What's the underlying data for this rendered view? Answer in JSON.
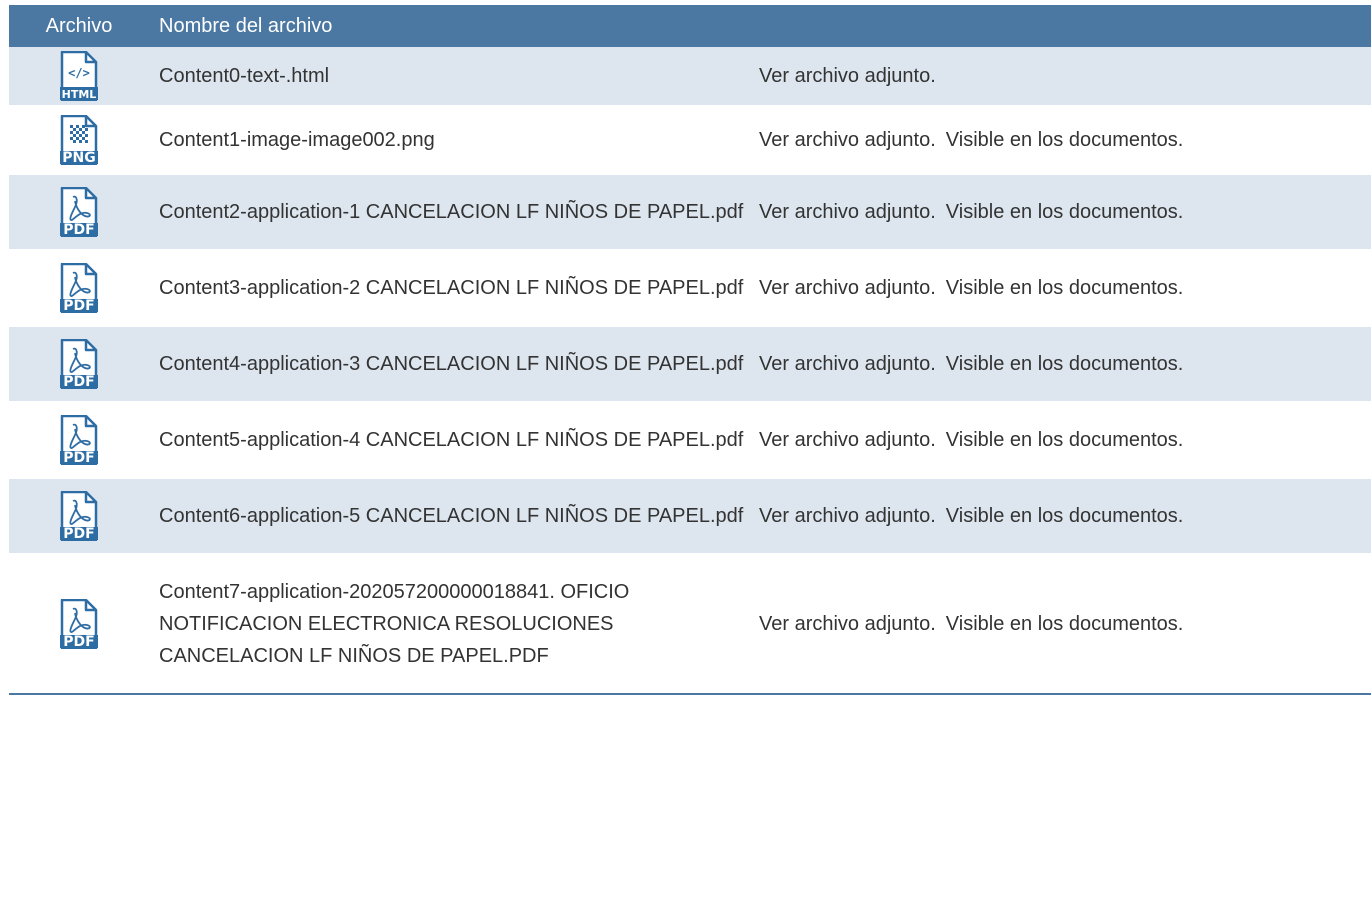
{
  "header": {
    "col_file": "Archivo",
    "col_name": "Nombre del archivo"
  },
  "colors": {
    "header_bg": "#4a78a2",
    "row_alt_bg": "#dde6ef",
    "icon_blue": "#2e6da4"
  },
  "rows": [
    {
      "icon": "html-file-icon",
      "icon_label": "HTML",
      "name": "Content0-text-.html",
      "note_view": "Ver archivo adjunto.",
      "note_visible": ""
    },
    {
      "icon": "png-file-icon",
      "icon_label": "PNG",
      "name": "Content1-image-image002.png",
      "note_view": "Ver archivo adjunto.",
      "note_visible": "Visible en los documentos."
    },
    {
      "icon": "pdf-file-icon",
      "icon_label": "PDF",
      "name": "Content2-application-1 CANCELACION LF NIÑOS DE PAPEL.pdf",
      "note_view": "Ver archivo adjunto.",
      "note_visible": "Visible en los documentos."
    },
    {
      "icon": "pdf-file-icon",
      "icon_label": "PDF",
      "name": "Content3-application-2 CANCELACION LF NIÑOS DE PAPEL.pdf",
      "note_view": "Ver archivo adjunto.",
      "note_visible": "Visible en los documentos."
    },
    {
      "icon": "pdf-file-icon",
      "icon_label": "PDF",
      "name": "Content4-application-3 CANCELACION LF NIÑOS DE PAPEL.pdf",
      "note_view": "Ver archivo adjunto.",
      "note_visible": "Visible en los documentos."
    },
    {
      "icon": "pdf-file-icon",
      "icon_label": "PDF",
      "name": "Content5-application-4 CANCELACION LF NIÑOS DE PAPEL.pdf",
      "note_view": "Ver archivo adjunto.",
      "note_visible": "Visible en los documentos."
    },
    {
      "icon": "pdf-file-icon",
      "icon_label": "PDF",
      "name": "Content6-application-5 CANCELACION LF NIÑOS DE PAPEL.pdf",
      "note_view": "Ver archivo adjunto.",
      "note_visible": "Visible en los documentos."
    },
    {
      "icon": "pdf-file-icon",
      "icon_label": "PDF",
      "name": "Content7-application-202057200000018841. OFICIO NOTIFICACION ELECTRONICA RESOLUCIONES CANCELACION LF NIÑOS DE PAPEL.PDF",
      "note_view": "Ver archivo adjunto.",
      "note_visible": "Visible en los documentos."
    }
  ]
}
